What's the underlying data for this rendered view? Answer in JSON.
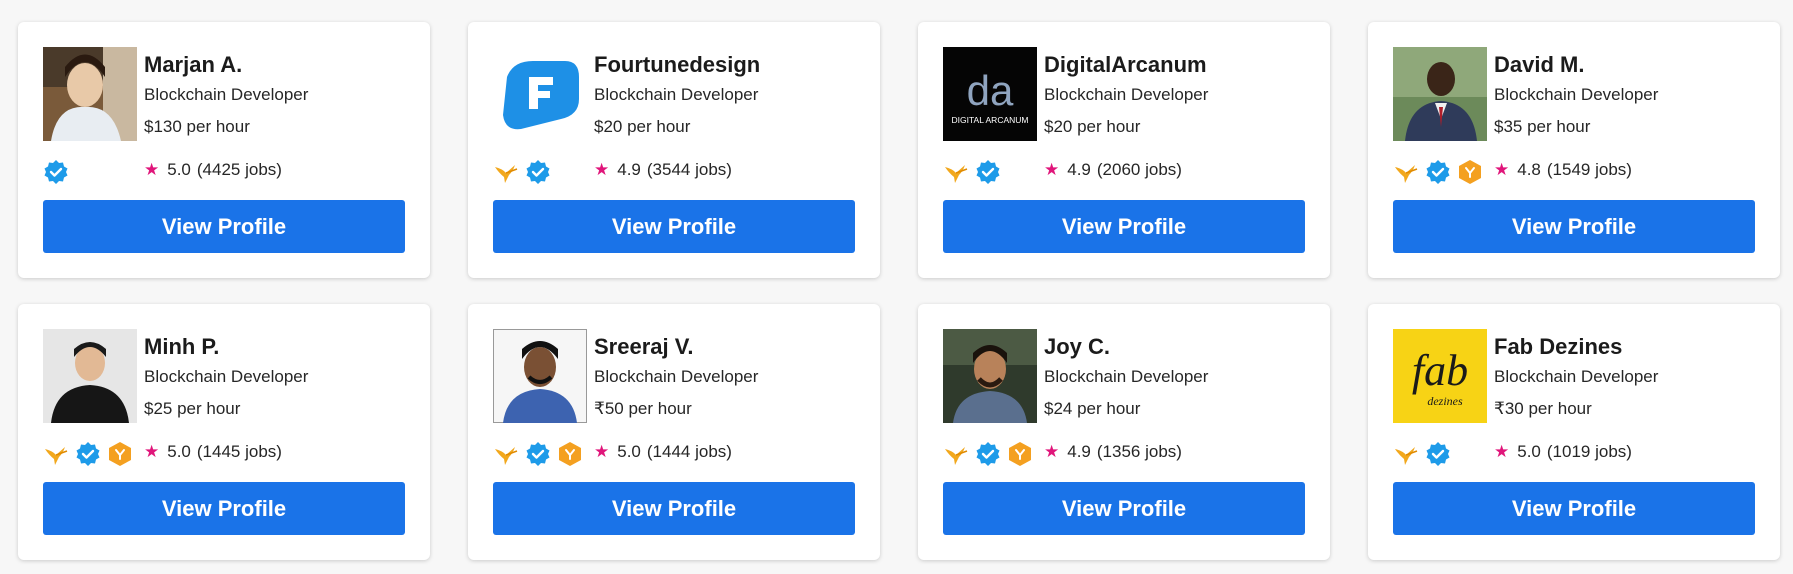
{
  "view_profile_label": "View Profile",
  "colors": {
    "button": "#1a73e8",
    "star": "#e0157a",
    "verified": "#1e9be9",
    "top_rated": "#f4a020"
  },
  "freelancers": [
    {
      "name": "Marjan A.",
      "role": "Blockchain Developer",
      "rate": "$130 per hour",
      "rating": "5.0",
      "jobs": "(4425 jobs)",
      "badges": [
        "verified-icon"
      ],
      "avatar": "photo-woman"
    },
    {
      "name": "Fourtunedesign",
      "role": "Blockchain Developer",
      "rate": "$20 per hour",
      "rating": "4.9",
      "jobs": "(3544 jobs)",
      "badges": [
        "hummingbird-icon",
        "verified-icon"
      ],
      "avatar": "logo-f"
    },
    {
      "name": "DigitalArcanum",
      "role": "Blockchain Developer",
      "rate": "$20 per hour",
      "rating": "4.9",
      "jobs": "(2060 jobs)",
      "badges": [
        "hummingbird-icon",
        "verified-icon"
      ],
      "avatar": "logo-da",
      "avatar_text": "da",
      "avatar_caption": "DIGITAL ARCANUM"
    },
    {
      "name": "David M.",
      "role": "Blockchain Developer",
      "rate": "$35 per hour",
      "rating": "4.8",
      "jobs": "(1549 jobs)",
      "badges": [
        "hummingbird-icon",
        "verified-icon",
        "top-rated-icon"
      ],
      "avatar": "photo-man-suit"
    },
    {
      "name": "Minh P.",
      "role": "Blockchain Developer",
      "rate": "$25 per hour",
      "rating": "5.0",
      "jobs": "(1445 jobs)",
      "badges": [
        "hummingbird-icon",
        "verified-icon",
        "top-rated-icon"
      ],
      "avatar": "photo-man-black"
    },
    {
      "name": "Sreeraj V.",
      "role": "Blockchain Developer",
      "rate": "₹50 per hour",
      "rating": "5.0",
      "jobs": "(1444 jobs)",
      "badges": [
        "hummingbird-icon",
        "verified-icon",
        "top-rated-icon"
      ],
      "avatar": "photo-man-white"
    },
    {
      "name": "Joy C.",
      "role": "Blockchain Developer",
      "rate": "$24 per hour",
      "rating": "4.9",
      "jobs": "(1356 jobs)",
      "badges": [
        "hummingbird-icon",
        "verified-icon",
        "top-rated-icon"
      ],
      "avatar": "photo-man-dark"
    },
    {
      "name": "Fab Dezines",
      "role": "Blockchain Developer",
      "rate": "₹30 per hour",
      "rating": "5.0",
      "jobs": "(1019 jobs)",
      "badges": [
        "hummingbird-icon",
        "verified-icon"
      ],
      "avatar": "logo-fab",
      "avatar_text": "fab",
      "avatar_caption": "dezines"
    }
  ]
}
